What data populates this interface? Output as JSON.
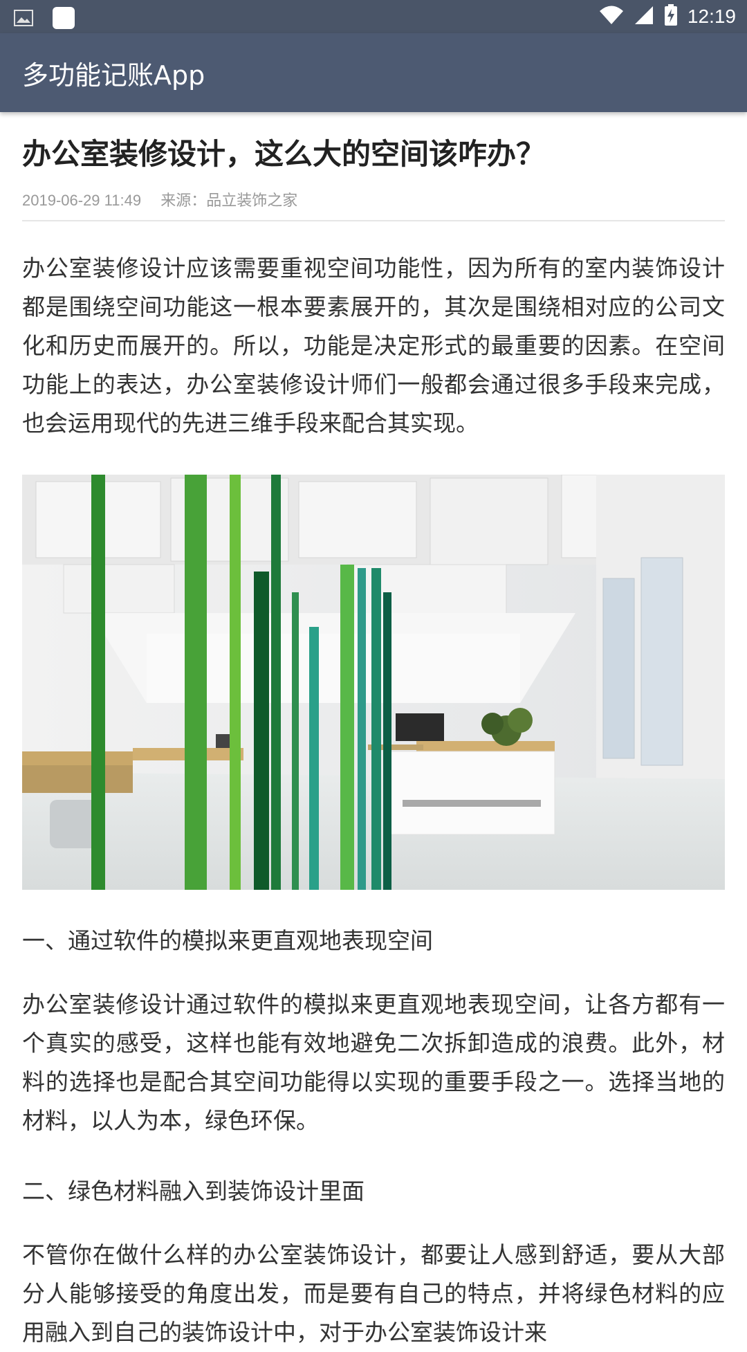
{
  "status_bar": {
    "time": "12:19",
    "icons": [
      "gallery-icon",
      "notification-square-icon",
      "wifi-icon",
      "signal-icon",
      "battery-charging-icon"
    ]
  },
  "app_bar": {
    "title": "多功能记账App",
    "color": "#4d5a72"
  },
  "article": {
    "title": "办公室装修设计，这么大的空间该咋办？",
    "date": "2019-06-29 11:49",
    "source": "来源：品立装饰之家",
    "paragraph1": "办公室装修设计应该需要重视空间功能性，因为所有的室内装饰设计都是围绕空间功能这一根本要素展开的，其次是围绕相对应的公司文化和历史而展开的。所以，功能是决定形式的最重要的因素。在空间功能上的表达，办公室装修设计师们一般都会通过很多手段来完成，也会运用现代的先进三维手段来配合其实现。",
    "image_subject": "office-interior-photo",
    "heading1": "一、通过软件的模拟来更直观地表现空间",
    "paragraph2": "办公室装修设计通过软件的模拟来更直观地表现空间，让各方都有一个真实的感受，这样也能有效地避免二次拆卸造成的浪费。此外，材料的选择也是配合其空间功能得以实现的重要手段之一。选择当地的材料，以人为本，绿色环保。",
    "heading2": "二、绿色材料融入到装饰设计里面",
    "paragraph3": "不管你在做什么样的办公室装饰设计，都要让人感到舒适，要从大部分人能够接受的角度出发，而是要有自己的特点，并将绿色材料的应用融入到自己的装饰设计中，对于办公室装饰设计来"
  }
}
